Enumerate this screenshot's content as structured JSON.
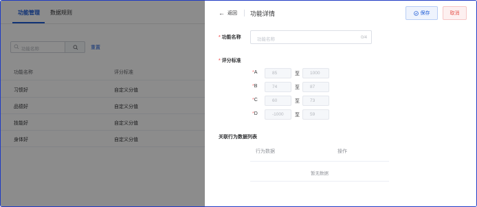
{
  "background": {
    "tabs": [
      {
        "label": "功能管理",
        "active": true
      },
      {
        "label": "数据规则",
        "active": false
      }
    ],
    "search": {
      "placeholder": "功能名称",
      "reset_label": "重置"
    },
    "table": {
      "headers": [
        "功能名称",
        "评分标准"
      ],
      "rows": [
        {
          "name": "习惯好",
          "standard": "自定义分值"
        },
        {
          "name": "品德好",
          "standard": "自定义分值"
        },
        {
          "name": "技能好",
          "standard": "自定义分值"
        },
        {
          "name": "身体好",
          "standard": "自定义分值"
        }
      ]
    }
  },
  "drawer": {
    "back_label": "返回",
    "title": "功能详情",
    "save_label": "保存",
    "cancel_label": "取消",
    "name_field": {
      "label": "功能名称",
      "placeholder": "功能名称",
      "counter": "0/4"
    },
    "score": {
      "label": "评分标准",
      "to_label": "至",
      "grades": [
        {
          "letter": "A",
          "min": "85",
          "max": "1000"
        },
        {
          "letter": "B",
          "min": "74",
          "max": "87"
        },
        {
          "letter": "C",
          "min": "60",
          "max": "73"
        },
        {
          "letter": "D",
          "min": "-1000",
          "max": "59"
        }
      ]
    },
    "behavior_list": {
      "title": "关联行为数据列表",
      "headers": [
        "行为数据",
        "操作"
      ],
      "empty_text": "暂无数据"
    }
  },
  "colors": {
    "accent": "#1d5bd6",
    "danger": "#e5534b",
    "required": "#f56c6c",
    "mask": "rgba(0,0,0,0.45)"
  }
}
